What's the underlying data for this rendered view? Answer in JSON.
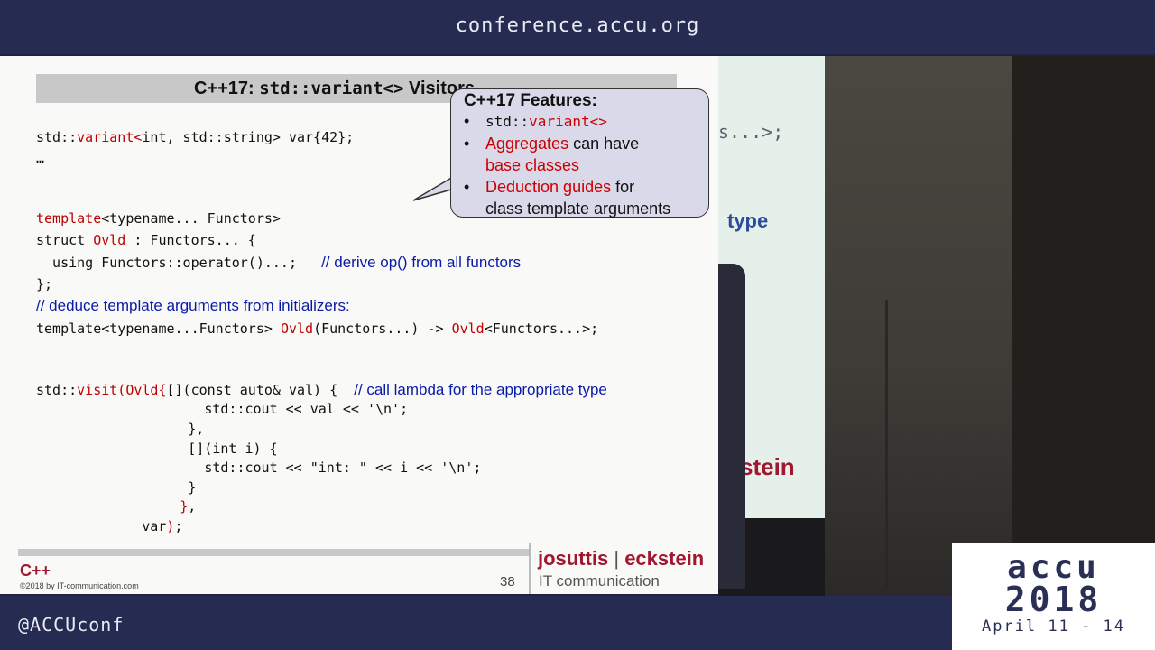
{
  "banner": {
    "site": "conference.accu.org",
    "handle": "@ACCUconf"
  },
  "logo": {
    "line1": "accu",
    "line2": "2018",
    "dates": "April 11 - 14"
  },
  "slide": {
    "title_prefix": "C++17: ",
    "title_mono": "std::variant<>",
    "title_suffix": " Visitors",
    "code": {
      "l1_a": "std::",
      "l1_b": "variant<",
      "l1_c": "int, std::string> var{42};",
      "l2": "…",
      "l3_a": "template",
      "l3_b": "<typename... Functors>",
      "l4_a": "struct ",
      "l4_b": "Ovld",
      "l4_c": " : Functors... {",
      "l5_a": "  using Functors::operator()...;   ",
      "l5_comment": "// derive op() from all functors",
      "l6": "};",
      "l7_comment": "// deduce template arguments from initializers:",
      "l8_a": "template<typename...Functors> ",
      "l8_b": "Ovld",
      "l8_c": "(Functors...) -> ",
      "l8_d": "Ovld",
      "l8_e": "<Functors...>;",
      "l9_a": "std::",
      "l9_b": "visit(Ovld{",
      "l9_c": "[](const auto& val) {  ",
      "l9_comment": "// call lambda for the appropriate type",
      "l10": "           std::cout << val << '\\n';",
      "l11": "         },",
      "l12": "         [](int i) {",
      "l13": "           std::cout << \"int: \" << i << '\\n';",
      "l14": "         }",
      "l15_a": "        ",
      "l15_b": "}",
      "l15_c": ",",
      "l16_a": "       var",
      "l16_b": ")",
      "l16_c": ";"
    },
    "callout": {
      "heading": "C++17 Features:",
      "bullet": "•",
      "item1_mono_a": "std::",
      "item1_mono_b": "variant<>",
      "item2_red": "Aggregates",
      "item2_rest": " can have",
      "item2_line2": "base classes",
      "item3_red": "Deduction guides",
      "item3_rest": " for",
      "item3_line2": "class template arguments"
    },
    "footer": {
      "cpp": "C++",
      "copyright": "©2018 by IT-communication.com",
      "page": "38",
      "brand_a": "josuttis",
      "brand_sep": " | ",
      "brand_b": "eckstein",
      "brand_sub": "IT communication"
    }
  },
  "camera": {
    "frag1": "s...>;",
    "frag2": "type",
    "frag3": "stein"
  },
  "colors": {
    "keyword_red": "#c00000",
    "comment_blue": "#0a1aa8",
    "brand_red": "#a01830",
    "banner": "#262b52"
  }
}
